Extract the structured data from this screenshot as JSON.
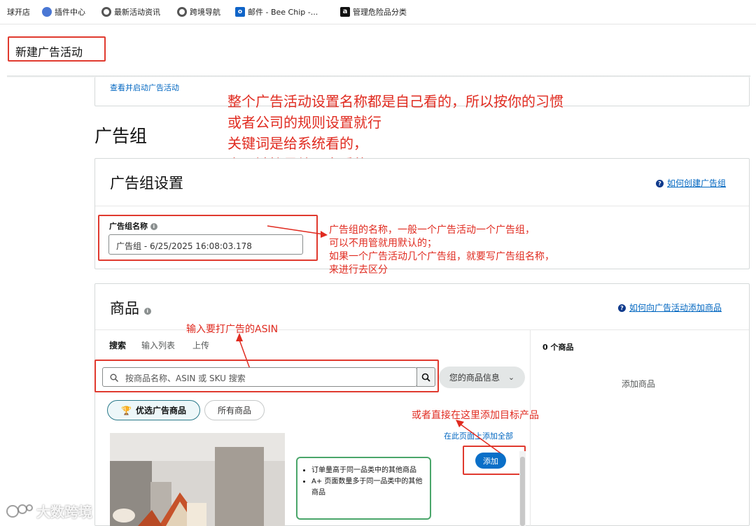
{
  "bookmarks": [
    {
      "label": "球开店",
      "icon": "none"
    },
    {
      "label": "插件中心",
      "icon": "plugin-icon"
    },
    {
      "label": "最新活动资讯",
      "icon": "globe-icon"
    },
    {
      "label": "跨境导航",
      "icon": "globe-icon"
    },
    {
      "label": "邮件 - Bee Chip -...",
      "icon": "outlook-icon"
    },
    {
      "label": "管理危险品分类",
      "icon": "amazon-icon"
    }
  ],
  "header": {
    "page_title": "新建广告活动"
  },
  "campaign_card": {
    "view_link": "查看并启动广告活动"
  },
  "ad_group": {
    "section_title": "广告组",
    "settings_title": "广告组设置",
    "help_link": "如何创建广告组",
    "name_label": "广告组名称",
    "name_value": "广告组 - 6/25/2025 16:08:03.178"
  },
  "products": {
    "title": "商品",
    "help_link": "如何向广告活动添加商品",
    "tabs": [
      "搜索",
      "输入列表",
      "上传"
    ],
    "search_placeholder": "按商品名称、ASIN 或 SKU 搜索",
    "your_info_button": "您的商品信息",
    "filter_featured": "优选广告商品",
    "filter_all": "所有商品",
    "add_all_link": "在此页面上添加全部",
    "add_button": "添加",
    "count_label": "0 个商品",
    "empty_label": "添加商品",
    "benefits": [
      "订单量高于同一品类中的其他商品",
      "A+ 页面数量多于同一品类中的其他商品"
    ]
  },
  "annotations": {
    "top_lines": [
      "整个广告活动设置名称都是自己看的，所以按你的习惯",
      "或者公司的规则设置就行",
      "关键词是给系统看的，",
      "产品链接是给买家看的"
    ],
    "group_name_lines": [
      "广告组的名称，一般一个广告活动一个广告组，",
      "可以不用管就用默认的；",
      "如果一个广告活动几个广告组，就要写广告组名称，",
      "来进行去区分"
    ],
    "asin_note": "输入要打广告的ASIN",
    "add_note": "或者直接在这里添加目标产品"
  },
  "watermark": "大数跨境",
  "colors": {
    "annotation_red": "#e02b20",
    "link_blue": "#0066c0",
    "add_button_blue": "#0a6fc8",
    "benefit_green": "#4aa66a"
  }
}
